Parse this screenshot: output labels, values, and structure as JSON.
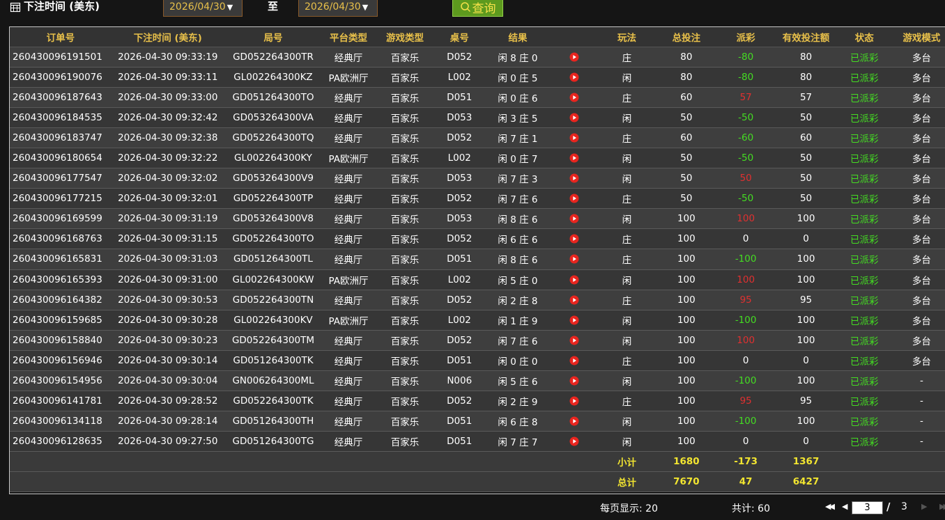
{
  "filter": {
    "label": "下注时间 (美东)",
    "start_date": "2026/04/30",
    "to_label": "至",
    "end_date": "2026/04/30",
    "query_label": "查询"
  },
  "table": {
    "headers": [
      "订单号",
      "下注时间 (美东)",
      "局号",
      "平台类型",
      "游戏类型",
      "桌号",
      "结果",
      "",
      "玩法",
      "总投注",
      "派彩",
      "有效投注额",
      "状态",
      "游戏模式"
    ],
    "rows": [
      {
        "order": "260430096191501",
        "time": "2026-04-30 09:33:19",
        "round": "GD052264300TR",
        "platform": "经典厅",
        "game": "百家乐",
        "table": "D052",
        "result": "闲 8 庄 0",
        "play": "庄",
        "bet": "80",
        "payout": "-80",
        "valid": "80",
        "status": "已派彩",
        "mode": "多台"
      },
      {
        "order": "260430096190076",
        "time": "2026-04-30 09:33:11",
        "round": "GL002264300KZ",
        "platform": "PA欧洲厅",
        "game": "百家乐",
        "table": "L002",
        "result": "闲 0 庄 5",
        "play": "闲",
        "bet": "80",
        "payout": "-80",
        "valid": "80",
        "status": "已派彩",
        "mode": "多台"
      },
      {
        "order": "260430096187643",
        "time": "2026-04-30 09:33:00",
        "round": "GD051264300TO",
        "platform": "经典厅",
        "game": "百家乐",
        "table": "D051",
        "result": "闲 0 庄 6",
        "play": "庄",
        "bet": "60",
        "payout": "57",
        "valid": "57",
        "status": "已派彩",
        "mode": "多台"
      },
      {
        "order": "260430096184535",
        "time": "2026-04-30 09:32:42",
        "round": "GD053264300VA",
        "platform": "经典厅",
        "game": "百家乐",
        "table": "D053",
        "result": "闲 3 庄 5",
        "play": "闲",
        "bet": "50",
        "payout": "-50",
        "valid": "50",
        "status": "已派彩",
        "mode": "多台"
      },
      {
        "order": "260430096183747",
        "time": "2026-04-30 09:32:38",
        "round": "GD052264300TQ",
        "platform": "经典厅",
        "game": "百家乐",
        "table": "D052",
        "result": "闲 7 庄 1",
        "play": "庄",
        "bet": "60",
        "payout": "-60",
        "valid": "60",
        "status": "已派彩",
        "mode": "多台"
      },
      {
        "order": "260430096180654",
        "time": "2026-04-30 09:32:22",
        "round": "GL002264300KY",
        "platform": "PA欧洲厅",
        "game": "百家乐",
        "table": "L002",
        "result": "闲 0 庄 7",
        "play": "闲",
        "bet": "50",
        "payout": "-50",
        "valid": "50",
        "status": "已派彩",
        "mode": "多台"
      },
      {
        "order": "260430096177547",
        "time": "2026-04-30 09:32:02",
        "round": "GD053264300V9",
        "platform": "经典厅",
        "game": "百家乐",
        "table": "D053",
        "result": "闲 7 庄 3",
        "play": "闲",
        "bet": "50",
        "payout": "50",
        "valid": "50",
        "status": "已派彩",
        "mode": "多台"
      },
      {
        "order": "260430096177215",
        "time": "2026-04-30 09:32:01",
        "round": "GD052264300TP",
        "platform": "经典厅",
        "game": "百家乐",
        "table": "D052",
        "result": "闲 7 庄 6",
        "play": "庄",
        "bet": "50",
        "payout": "-50",
        "valid": "50",
        "status": "已派彩",
        "mode": "多台"
      },
      {
        "order": "260430096169599",
        "time": "2026-04-30 09:31:19",
        "round": "GD053264300V8",
        "platform": "经典厅",
        "game": "百家乐",
        "table": "D053",
        "result": "闲 8 庄 6",
        "play": "闲",
        "bet": "100",
        "payout": "100",
        "valid": "100",
        "status": "已派彩",
        "mode": "多台"
      },
      {
        "order": "260430096168763",
        "time": "2026-04-30 09:31:15",
        "round": "GD052264300TO",
        "platform": "经典厅",
        "game": "百家乐",
        "table": "D052",
        "result": "闲 6 庄 6",
        "play": "庄",
        "bet": "100",
        "payout": "0",
        "valid": "0",
        "status": "已派彩",
        "mode": "多台"
      },
      {
        "order": "260430096165831",
        "time": "2026-04-30 09:31:03",
        "round": "GD051264300TL",
        "platform": "经典厅",
        "game": "百家乐",
        "table": "D051",
        "result": "闲 8 庄 6",
        "play": "庄",
        "bet": "100",
        "payout": "-100",
        "valid": "100",
        "status": "已派彩",
        "mode": "多台"
      },
      {
        "order": "260430096165393",
        "time": "2026-04-30 09:31:00",
        "round": "GL002264300KW",
        "platform": "PA欧洲厅",
        "game": "百家乐",
        "table": "L002",
        "result": "闲 5 庄 0",
        "play": "闲",
        "bet": "100",
        "payout": "100",
        "valid": "100",
        "status": "已派彩",
        "mode": "多台"
      },
      {
        "order": "260430096164382",
        "time": "2026-04-30 09:30:53",
        "round": "GD052264300TN",
        "platform": "经典厅",
        "game": "百家乐",
        "table": "D052",
        "result": "闲 2 庄 8",
        "play": "庄",
        "bet": "100",
        "payout": "95",
        "valid": "95",
        "status": "已派彩",
        "mode": "多台"
      },
      {
        "order": "260430096159685",
        "time": "2026-04-30 09:30:28",
        "round": "GL002264300KV",
        "platform": "PA欧洲厅",
        "game": "百家乐",
        "table": "L002",
        "result": "闲 1 庄 9",
        "play": "闲",
        "bet": "100",
        "payout": "-100",
        "valid": "100",
        "status": "已派彩",
        "mode": "多台"
      },
      {
        "order": "260430096158840",
        "time": "2026-04-30 09:30:23",
        "round": "GD052264300TM",
        "platform": "经典厅",
        "game": "百家乐",
        "table": "D052",
        "result": "闲 7 庄 6",
        "play": "闲",
        "bet": "100",
        "payout": "100",
        "valid": "100",
        "status": "已派彩",
        "mode": "多台"
      },
      {
        "order": "260430096156946",
        "time": "2026-04-30 09:30:14",
        "round": "GD051264300TK",
        "platform": "经典厅",
        "game": "百家乐",
        "table": "D051",
        "result": "闲 0 庄 0",
        "play": "庄",
        "bet": "100",
        "payout": "0",
        "valid": "0",
        "status": "已派彩",
        "mode": "多台"
      },
      {
        "order": "260430096154956",
        "time": "2026-04-30 09:30:04",
        "round": "GN006264300ML",
        "platform": "经典厅",
        "game": "百家乐",
        "table": "N006",
        "result": "闲 5 庄 6",
        "play": "闲",
        "bet": "100",
        "payout": "-100",
        "valid": "100",
        "status": "已派彩",
        "mode": "-"
      },
      {
        "order": "260430096141781",
        "time": "2026-04-30 09:28:52",
        "round": "GD052264300TK",
        "platform": "经典厅",
        "game": "百家乐",
        "table": "D052",
        "result": "闲 2 庄 9",
        "play": "庄",
        "bet": "100",
        "payout": "95",
        "valid": "95",
        "status": "已派彩",
        "mode": "-"
      },
      {
        "order": "260430096134118",
        "time": "2026-04-30 09:28:14",
        "round": "GD051264300TH",
        "platform": "经典厅",
        "game": "百家乐",
        "table": "D051",
        "result": "闲 6 庄 8",
        "play": "闲",
        "bet": "100",
        "payout": "-100",
        "valid": "100",
        "status": "已派彩",
        "mode": "-"
      },
      {
        "order": "260430096128635",
        "time": "2026-04-30 09:27:50",
        "round": "GD051264300TG",
        "platform": "经典厅",
        "game": "百家乐",
        "table": "D051",
        "result": "闲 7 庄 7",
        "play": "闲",
        "bet": "100",
        "payout": "0",
        "valid": "0",
        "status": "已派彩",
        "mode": "-"
      }
    ],
    "subtotal": {
      "label": "小计",
      "bet": "1680",
      "payout": "-173",
      "valid": "1367"
    },
    "total": {
      "label": "总计",
      "bet": "7670",
      "payout": "47",
      "valid": "6427"
    }
  },
  "pager": {
    "per_page": "每页显示: 20",
    "total_count": "共计: 60",
    "current_page": "3",
    "separator": "/",
    "total_pages": "3"
  },
  "colors": {
    "header_text": "#e8c04a",
    "payout_positive": "#e03030",
    "payout_negative": "#44dd22",
    "status_text": "#44dd22",
    "summary_text": "#f2e530",
    "query_button_bg": "#5d9a1e",
    "video_icon": "#e8251f"
  },
  "icons": {
    "filter_icon": "calendar-icon",
    "query_icon": "search-icon",
    "row_icon": "video-play-icon",
    "pager_icons": [
      "first-page-icon",
      "prev-page-icon",
      "next-page-icon",
      "last-page-icon"
    ]
  }
}
